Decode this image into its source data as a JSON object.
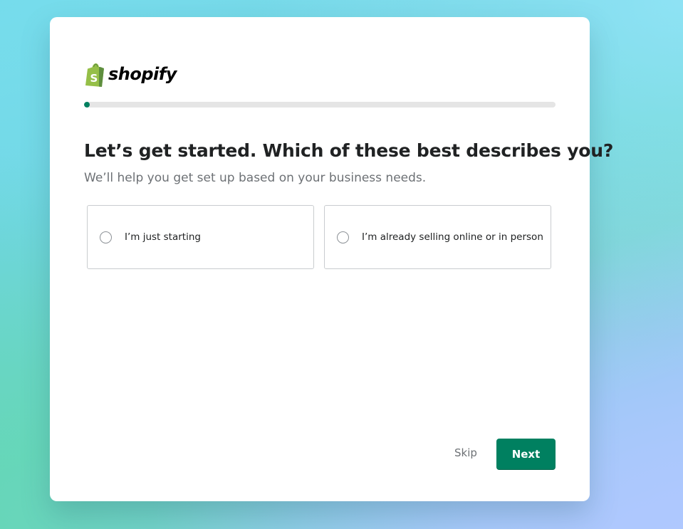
{
  "app": {
    "brand_name": "shopify",
    "brand_color": "#95bf47",
    "accent_color": "#008060"
  },
  "progress": {
    "fraction": 0.012
  },
  "question": {
    "title": "Let’s get started. Which of these best describes you?",
    "subtitle": "We’ll help you get set up based on your business needs."
  },
  "options": [
    {
      "label": "I’m just starting",
      "selected": false
    },
    {
      "label": "I’m already selling online or in person",
      "selected": false
    }
  ],
  "actions": {
    "skip_label": "Skip",
    "next_label": "Next"
  },
  "icons": {
    "logo": "shopify-bag-icon",
    "radio": "radio-unchecked-icon"
  }
}
